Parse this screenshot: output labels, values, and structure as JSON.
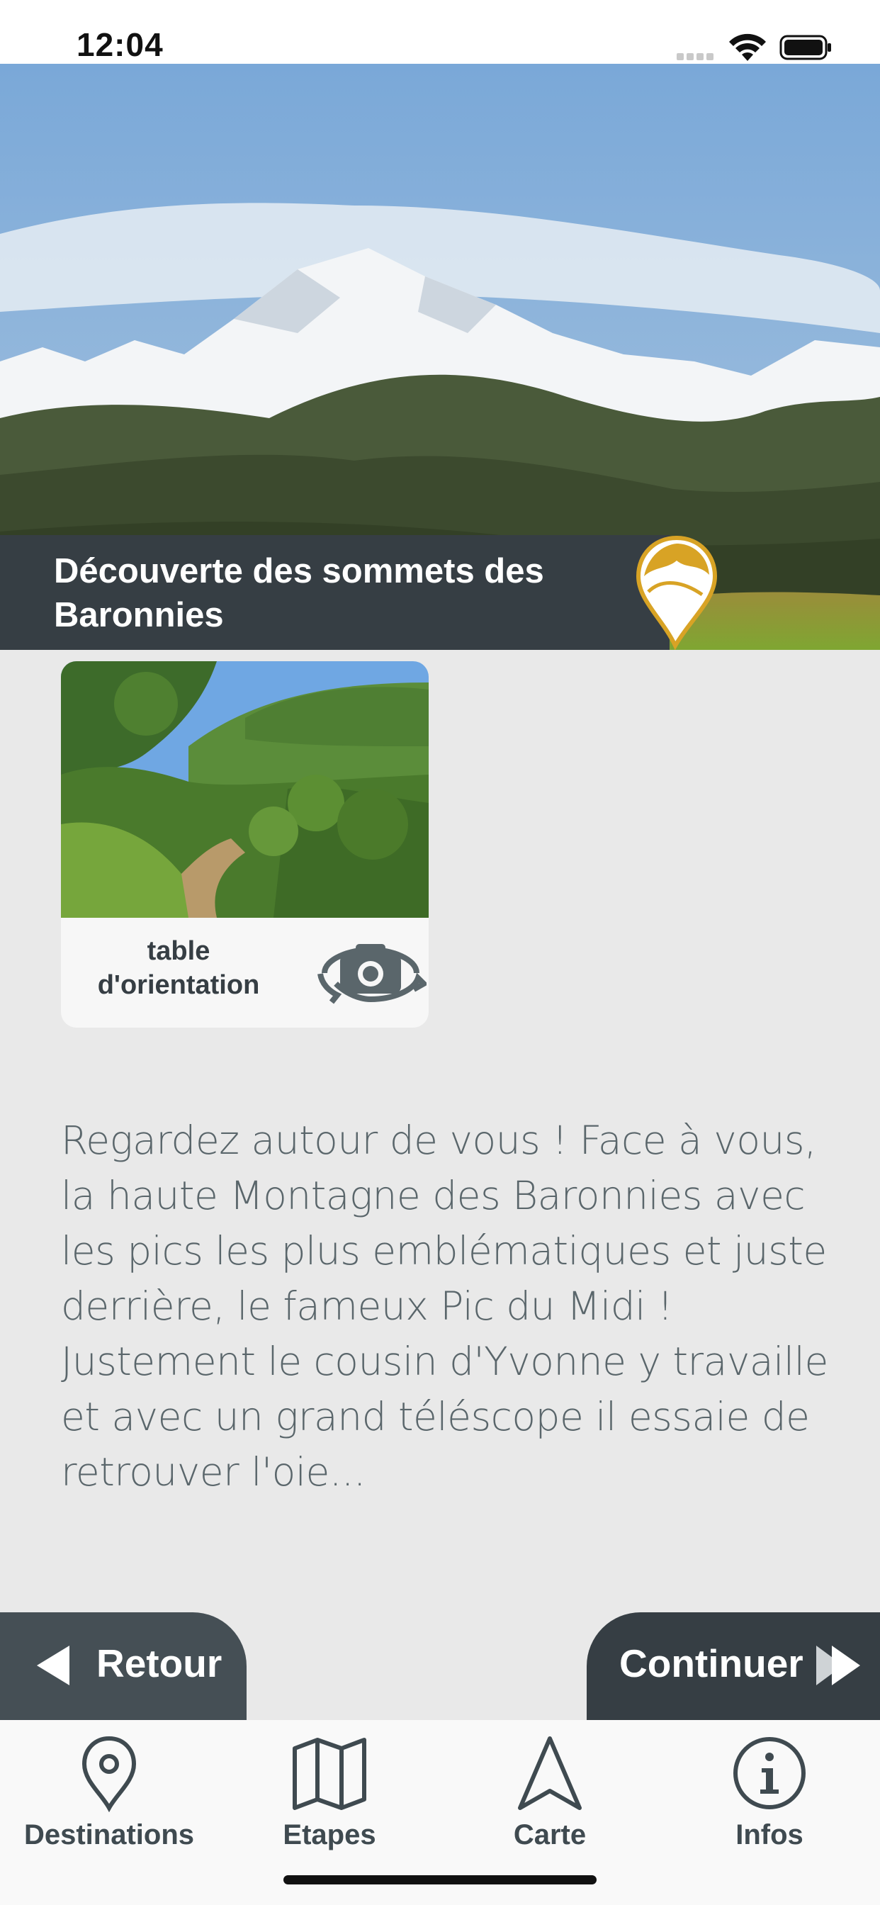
{
  "status_bar": {
    "time": "12:04"
  },
  "hero": {
    "title": "Découverte des sommets des Baronnies"
  },
  "card": {
    "label": "table d'orientation"
  },
  "description": "Regardez autour de vous ! Face à vous, la haute Montagne des Baronnies avec les pics les plus emblématiques et juste derrière, le fameux Pic du Midi ! Justement le cousin d'Yvonne y travaille et avec un grand téléscope il essaie de retrouver l'oie...",
  "navigation": {
    "back_label": "Retour",
    "next_label": "Continuer"
  },
  "tabs": [
    {
      "label": "Destinations",
      "icon": "location-pin-icon"
    },
    {
      "label": "Etapes",
      "icon": "map-icon"
    },
    {
      "label": "Carte",
      "icon": "navigation-arrow-icon"
    },
    {
      "label": "Infos",
      "icon": "info-icon"
    }
  ],
  "colors": {
    "dark_band": "#363e44",
    "accent_gold": "#d8a325",
    "background": "#e9e9e9",
    "text_grey": "#5a666b"
  }
}
